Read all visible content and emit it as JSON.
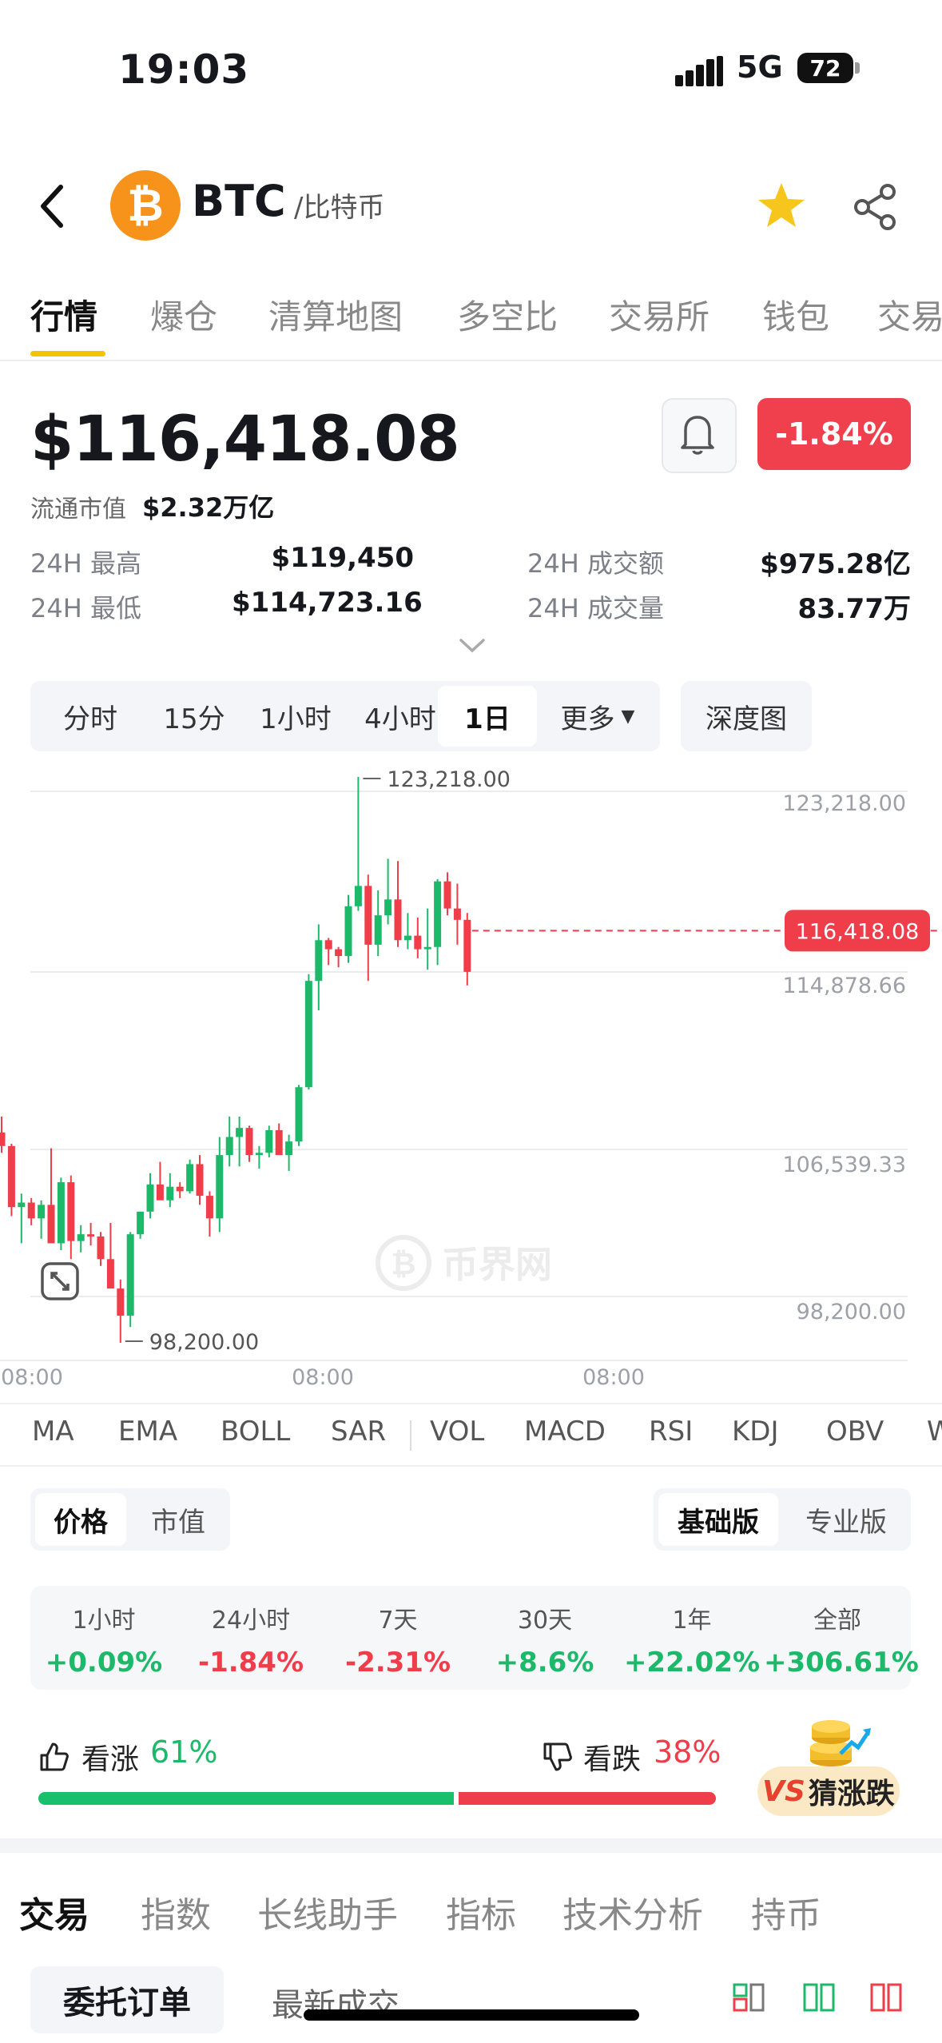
{
  "status": {
    "time": "19:03",
    "network": "5G",
    "battery": "72"
  },
  "header": {
    "symbol": "BTC",
    "name": "/比特币"
  },
  "tabs": [
    "行情",
    "爆仓",
    "清算地图",
    "多空比",
    "交易所",
    "钱包",
    "交易"
  ],
  "quote": {
    "price": "$116,418.08",
    "change": "-1.84%",
    "market_cap_label": "流通市值",
    "market_cap": "$2.32万亿"
  },
  "stats": [
    {
      "label": "24H 最高",
      "value": "$119,450"
    },
    {
      "label": "24H 成交额",
      "value": "$975.28亿"
    },
    {
      "label": "24H 最低",
      "value": "$114,723.16"
    },
    {
      "label": "24H 成交量",
      "value": "83.77万"
    }
  ],
  "periods": [
    "分时",
    "15分",
    "1小时",
    "4小时",
    "1日",
    "更多"
  ],
  "active_period": "1日",
  "depth_label": "深度图",
  "chart_data": {
    "type": "candlestick",
    "y_ticks": [
      123218.0,
      114878.66,
      106539.33,
      98200.0
    ],
    "y_tick_labels": [
      "123,218.00",
      "114,878.66",
      "106,539.33",
      "98,200.00"
    ],
    "x_tick_labels": [
      "08:00",
      "08:00",
      "08:00"
    ],
    "high_label": "123,218.00",
    "low_label": "98,200.00",
    "current_price_label": "116,418.08",
    "current_price": 116418.08,
    "ylim": [
      98200,
      123218
    ],
    "watermark": "币界网",
    "candles": [
      {
        "o": 107500,
        "h": 108200,
        "l": 106600,
        "c": 106900
      },
      {
        "o": 106900,
        "h": 107000,
        "l": 103800,
        "c": 104200
      },
      {
        "o": 104200,
        "h": 104800,
        "l": 102600,
        "c": 104400
      },
      {
        "o": 104400,
        "h": 104600,
        "l": 103400,
        "c": 103700
      },
      {
        "o": 103700,
        "h": 104500,
        "l": 102800,
        "c": 104300
      },
      {
        "o": 104300,
        "h": 106800,
        "l": 103500,
        "c": 102600
      },
      {
        "o": 102600,
        "h": 105500,
        "l": 102300,
        "c": 105300
      },
      {
        "o": 105300,
        "h": 105600,
        "l": 101900,
        "c": 102700
      },
      {
        "o": 102700,
        "h": 103400,
        "l": 102200,
        "c": 103000
      },
      {
        "o": 103000,
        "h": 103500,
        "l": 102500,
        "c": 102900
      },
      {
        "o": 102900,
        "h": 103100,
        "l": 101600,
        "c": 101900
      },
      {
        "o": 101900,
        "h": 103500,
        "l": 100700,
        "c": 100600
      },
      {
        "o": 100600,
        "h": 101000,
        "l": 98200,
        "c": 99400
      },
      {
        "o": 99400,
        "h": 103100,
        "l": 98900,
        "c": 103000
      },
      {
        "o": 103000,
        "h": 104000,
        "l": 102800,
        "c": 104000
      },
      {
        "o": 104000,
        "h": 105700,
        "l": 103700,
        "c": 105200
      },
      {
        "o": 105200,
        "h": 106200,
        "l": 104700,
        "c": 104500
      },
      {
        "o": 104500,
        "h": 105700,
        "l": 104200,
        "c": 105100
      },
      {
        "o": 105100,
        "h": 105300,
        "l": 104600,
        "c": 104900
      },
      {
        "o": 104900,
        "h": 106300,
        "l": 104800,
        "c": 106100
      },
      {
        "o": 106100,
        "h": 106500,
        "l": 104300,
        "c": 104700
      },
      {
        "o": 104700,
        "h": 104900,
        "l": 102900,
        "c": 103700
      },
      {
        "o": 103700,
        "h": 107300,
        "l": 103100,
        "c": 106500
      },
      {
        "o": 106500,
        "h": 108200,
        "l": 106000,
        "c": 107300
      },
      {
        "o": 107300,
        "h": 108200,
        "l": 106000,
        "c": 107700
      },
      {
        "o": 107700,
        "h": 107800,
        "l": 106200,
        "c": 106500
      },
      {
        "o": 106500,
        "h": 106900,
        "l": 105900,
        "c": 106600
      },
      {
        "o": 106600,
        "h": 107800,
        "l": 106400,
        "c": 107600
      },
      {
        "o": 107600,
        "h": 107900,
        "l": 106600,
        "c": 106500
      },
      {
        "o": 106500,
        "h": 107400,
        "l": 105800,
        "c": 107100
      },
      {
        "o": 107100,
        "h": 109600,
        "l": 106900,
        "c": 109500
      },
      {
        "o": 109500,
        "h": 114500,
        "l": 109400,
        "c": 114200
      },
      {
        "o": 114200,
        "h": 116700,
        "l": 112900,
        "c": 116000
      },
      {
        "o": 116000,
        "h": 116100,
        "l": 114900,
        "c": 115600
      },
      {
        "o": 115600,
        "h": 115700,
        "l": 114800,
        "c": 115300
      },
      {
        "o": 115300,
        "h": 118000,
        "l": 115000,
        "c": 117500
      },
      {
        "o": 117500,
        "h": 123218,
        "l": 117300,
        "c": 118400
      },
      {
        "o": 118400,
        "h": 118900,
        "l": 114200,
        "c": 115800
      },
      {
        "o": 115800,
        "h": 118200,
        "l": 115300,
        "c": 117100
      },
      {
        "o": 117100,
        "h": 119600,
        "l": 116700,
        "c": 117800
      },
      {
        "o": 117800,
        "h": 119500,
        "l": 115700,
        "c": 116000
      },
      {
        "o": 116000,
        "h": 117200,
        "l": 115600,
        "c": 116200
      },
      {
        "o": 116200,
        "h": 117000,
        "l": 115200,
        "c": 115600
      },
      {
        "o": 115600,
        "h": 117400,
        "l": 114700,
        "c": 115700
      },
      {
        "o": 115700,
        "h": 118700,
        "l": 114900,
        "c": 118600
      },
      {
        "o": 118600,
        "h": 119000,
        "l": 117100,
        "c": 117400
      },
      {
        "o": 117400,
        "h": 118500,
        "l": 115800,
        "c": 116900
      },
      {
        "o": 116900,
        "h": 117200,
        "l": 114000,
        "c": 114600
      }
    ]
  },
  "indicators": [
    "MA",
    "EMA",
    "BOLL",
    "SAR",
    "VOL",
    "MACD",
    "RSI",
    "KDJ",
    "OBV",
    "W"
  ],
  "value_toggle": [
    "价格",
    "市值"
  ],
  "version_toggle": [
    "基础版",
    "专业版"
  ],
  "performance": [
    {
      "label": "1小时",
      "value": "+0.09%",
      "dir": "up"
    },
    {
      "label": "24小时",
      "value": "-1.84%",
      "dir": "down"
    },
    {
      "label": "7天",
      "value": "-2.31%",
      "dir": "down"
    },
    {
      "label": "30天",
      "value": "+8.6%",
      "dir": "up"
    },
    {
      "label": "1年",
      "value": "+22.02%",
      "dir": "up"
    },
    {
      "label": "全部",
      "value": "+306.61%",
      "dir": "up"
    }
  ],
  "sentiment": {
    "bull_label": "看涨",
    "bull_value": "61%",
    "bull_pct": 61,
    "bear_label": "看跌",
    "bear_value": "38%",
    "bear_pct": 38
  },
  "guess": {
    "vs": "VS",
    "label": "猜涨跌"
  },
  "bottom_tabs": [
    "交易",
    "指数",
    "长线助手",
    "指标",
    "技术分析",
    "持币"
  ],
  "orders": {
    "entrust": "委托订单",
    "latest": "最新成交"
  },
  "colors": {
    "up": "#1db96a",
    "down": "#ef3e4a",
    "accent": "#f5c400",
    "bitcoin": "#f7931a"
  }
}
